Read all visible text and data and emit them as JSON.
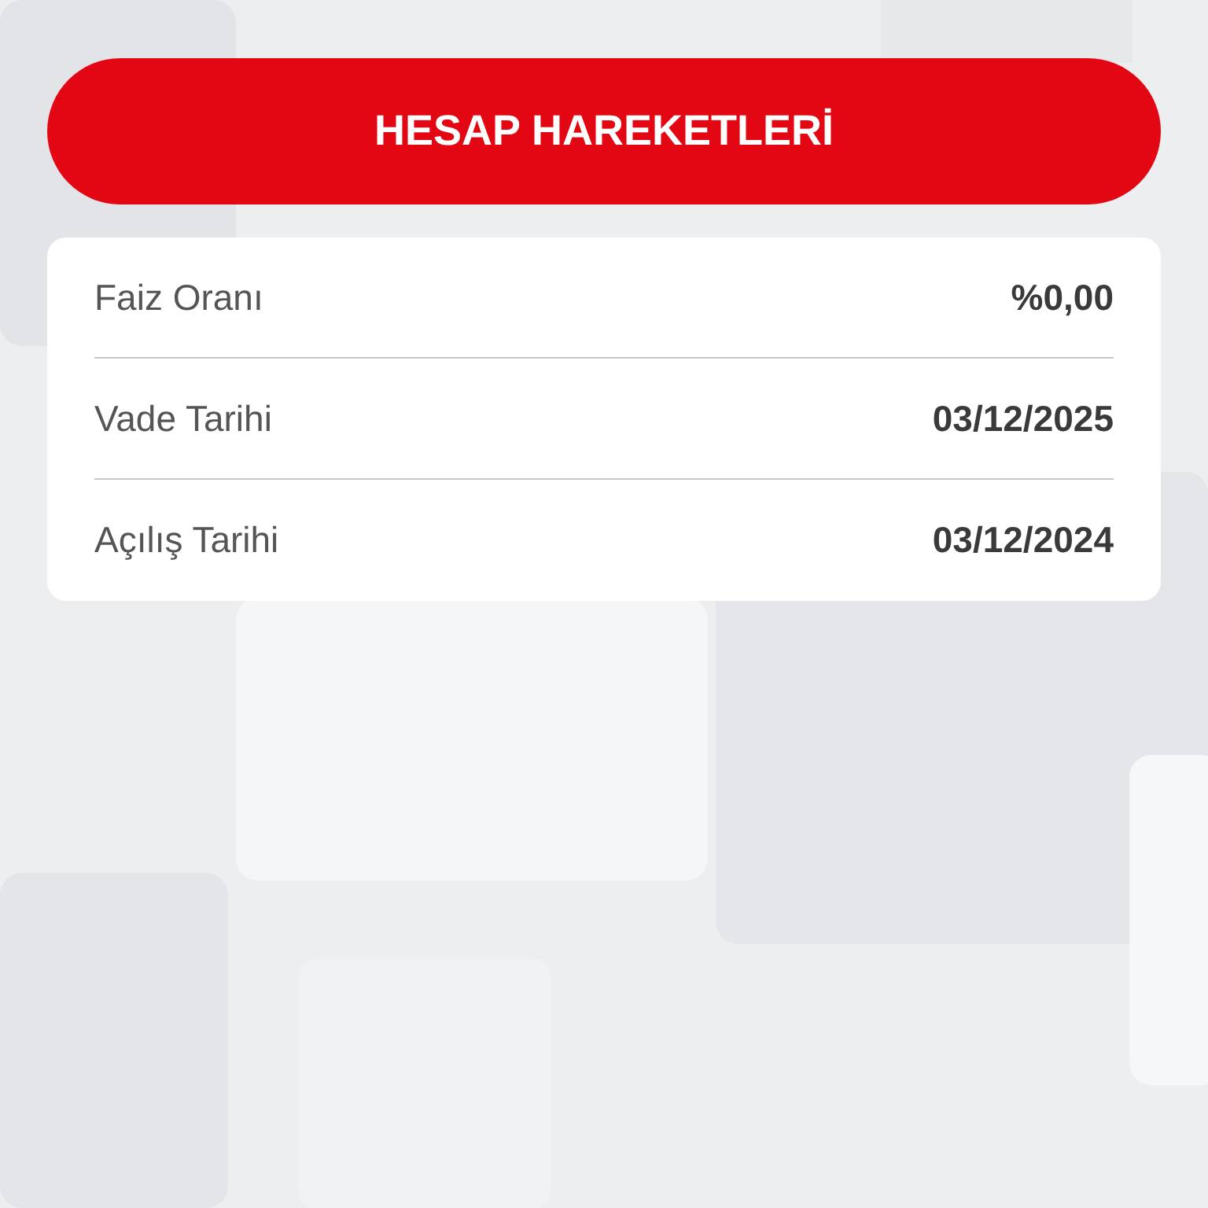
{
  "header_button": {
    "label": "HESAP HAREKETLERİ"
  },
  "details": [
    {
      "label": "Faiz Oranı",
      "value": "%0,00"
    },
    {
      "label": "Vade Tarihi",
      "value": "03/12/2025"
    },
    {
      "label": "Açılış Tarihi",
      "value": "03/12/2024"
    }
  ]
}
